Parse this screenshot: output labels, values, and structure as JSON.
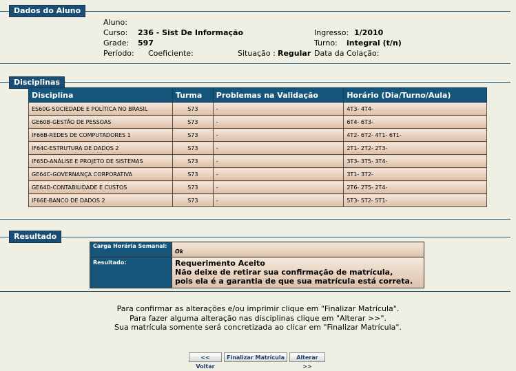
{
  "aluno_section": {
    "title": "Dados do Aluno",
    "aluno_label": "Aluno:",
    "curso_label": "Curso:",
    "curso_value": "236 - Sist De Informação",
    "grade_label": "Grade:",
    "grade_value": "597",
    "periodo_label": "Período:",
    "coeficiente_label": "Coeficiente:",
    "situacao_label": "Situação :",
    "situacao_value": "Regular",
    "data_colacao_label": "Data da Colação:",
    "ingresso_label": "Ingresso:",
    "ingresso_value": "1/2010",
    "turno_label": "Turno:",
    "turno_value": "integral (t/n)"
  },
  "disciplinas_section": {
    "title": "Disciplinas",
    "headers": [
      "Disciplina",
      "Turma",
      "Problemas na Validação",
      "Horário (Dia/Turno/Aula)"
    ],
    "rows": [
      {
        "disciplina": "ES60G-SOCIEDADE E POLÍTICA NO BRASIL",
        "turma": "S73",
        "problemas": "-",
        "horario": "4T3- 4T4-"
      },
      {
        "disciplina": "GE60B-GESTÃO DE PESSOAS",
        "turma": "S73",
        "problemas": "-",
        "horario": "6T4- 6T3-"
      },
      {
        "disciplina": "IF66B-REDES DE COMPUTADORES 1",
        "turma": "S73",
        "problemas": "-",
        "horario": "4T2- 6T2- 4T1- 6T1-"
      },
      {
        "disciplina": "IF64C-ESTRUTURA DE DADOS 2",
        "turma": "S73",
        "problemas": "-",
        "horario": "2T1- 2T2- 2T3-"
      },
      {
        "disciplina": "IF65D-ANÁLISE E PROJETO DE SISTEMAS",
        "turma": "S73",
        "problemas": "-",
        "horario": "3T3- 3T5- 3T4-"
      },
      {
        "disciplina": "GE64C-GOVERNANÇA CORPORATIVA",
        "turma": "S73",
        "problemas": "-",
        "horario": "3T1- 3T2-"
      },
      {
        "disciplina": "GE64D-CONTABILIDADE E CUSTOS",
        "turma": "S73",
        "problemas": "-",
        "horario": "2T6- 2T5- 2T4-"
      },
      {
        "disciplina": "IF66E-BANCO DE DADOS 2",
        "turma": "S73",
        "problemas": "-",
        "horario": "5T3- 5T2- 5T1-"
      }
    ]
  },
  "resultado_section": {
    "title": "Resultado",
    "carga_label": "Carga Horária Semanal:",
    "carga_value": "Ok",
    "resultado_label": "Resultado:",
    "resultado_line1": "Requerimento Aceito",
    "resultado_line2": "Não deixe de retirar sua confirmação de matrícula,",
    "resultado_line3": "pois ela é a garantia de que sua matrícula está correta."
  },
  "instructions": {
    "line1": "Para confirmar as alterações e/ou imprimir clique em \"Finalizar Matrícula\".",
    "line2": "Para fazer alguma alteração nas disciplinas clique em \"Alterar >>\".",
    "line3": "Sua matrícula somente será concretizada ao clicar em \"Finalizar Matrícula\"."
  },
  "buttons": {
    "voltar": "<< Voltar",
    "finalizar": "Finalizar Matrícula",
    "alterar": "Alterar >>"
  }
}
